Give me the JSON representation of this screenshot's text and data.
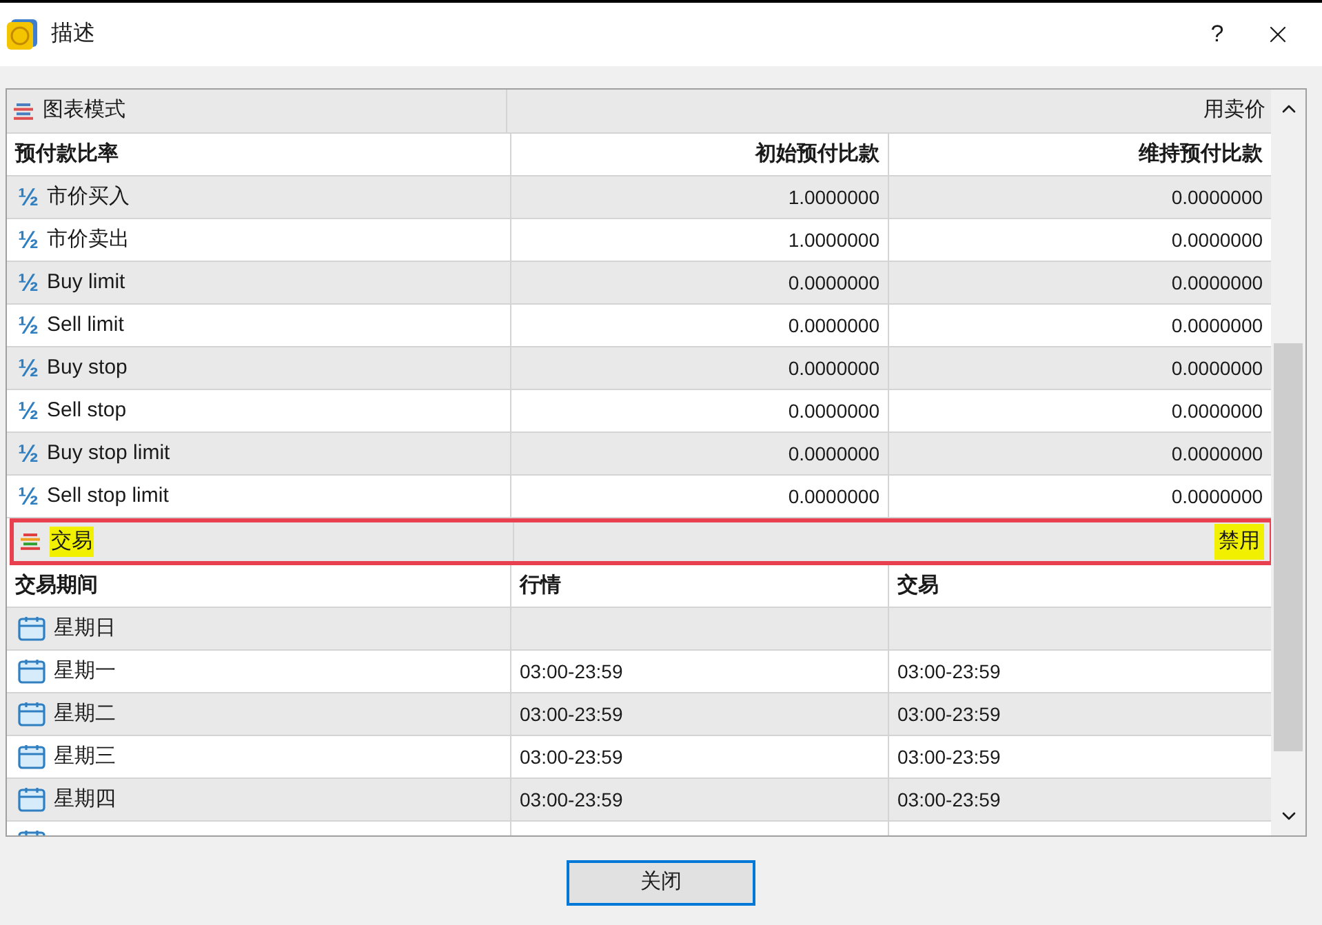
{
  "window": {
    "title": "描述",
    "help": "?"
  },
  "table": {
    "sections": [
      {
        "kind": "ratios",
        "label": "图表模式",
        "value": "用卖价",
        "highlighted": false,
        "header": [
          "预付款比率",
          "初始预付比款",
          "维持预付比款"
        ],
        "rows": [
          {
            "glyph": "½",
            "cells": [
              "市价买入",
              "1.0000000",
              "0.0000000"
            ]
          },
          {
            "glyph": "½",
            "cells": [
              "市价卖出",
              "1.0000000",
              "0.0000000"
            ]
          },
          {
            "glyph": "½",
            "cells": [
              "Buy limit",
              "0.0000000",
              "0.0000000"
            ]
          },
          {
            "glyph": "½",
            "cells": [
              "Sell limit",
              "0.0000000",
              "0.0000000"
            ]
          },
          {
            "glyph": "½",
            "cells": [
              "Buy stop",
              "0.0000000",
              "0.0000000"
            ]
          },
          {
            "glyph": "½",
            "cells": [
              "Sell stop",
              "0.0000000",
              "0.0000000"
            ]
          },
          {
            "glyph": "½",
            "cells": [
              "Buy stop limit",
              "0.0000000",
              "0.0000000"
            ]
          },
          {
            "glyph": "½",
            "cells": [
              "Sell stop limit",
              "0.0000000",
              "0.0000000"
            ]
          }
        ]
      },
      {
        "kind": "schedule",
        "label": "交易",
        "value": "禁用",
        "highlighted": true,
        "header": [
          "交易期间",
          "行情",
          "交易"
        ],
        "rows": [
          {
            "cells": [
              "星期日",
              "",
              ""
            ]
          },
          {
            "cells": [
              "星期一",
              "03:00-23:59",
              "03:00-23:59"
            ]
          },
          {
            "cells": [
              "星期二",
              "03:00-23:59",
              "03:00-23:59"
            ]
          },
          {
            "cells": [
              "星期三",
              "03:00-23:59",
              "03:00-23:59"
            ]
          },
          {
            "cells": [
              "星期四",
              "03:00-23:59",
              "03:00-23:59"
            ]
          },
          {
            "cells": [
              "",
              "",
              ""
            ]
          }
        ]
      }
    ]
  },
  "buttons": [
    {
      "label": "关闭",
      "default": true
    }
  ]
}
